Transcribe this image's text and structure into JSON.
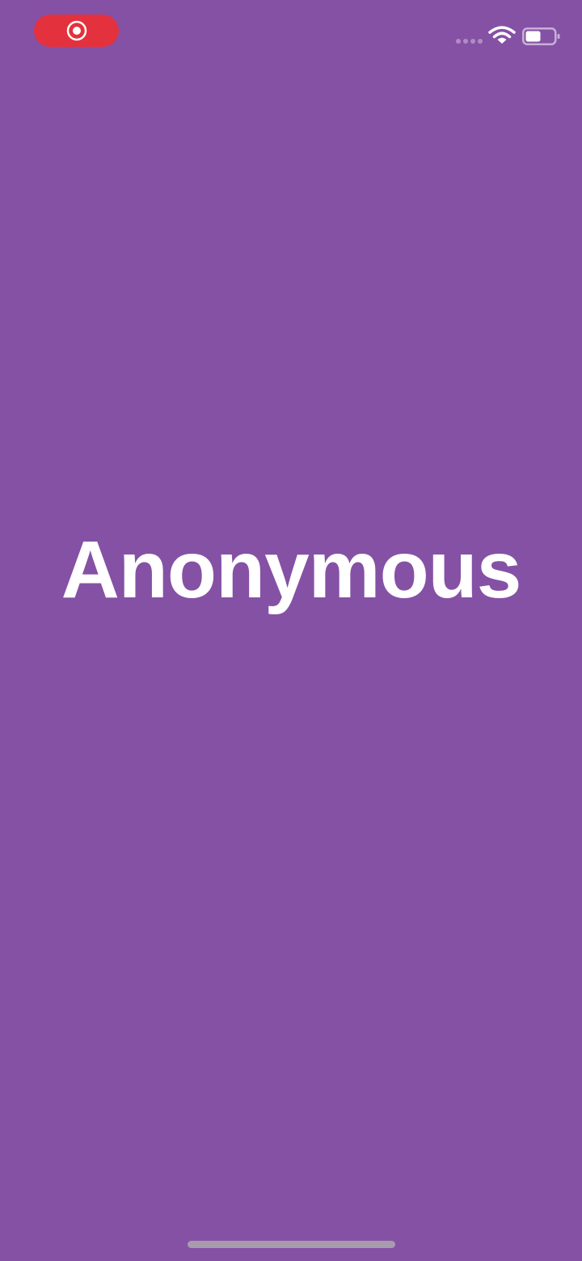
{
  "screen": {
    "background_color": "#8551A5",
    "title": "Anonymous"
  },
  "status_bar": {
    "recording_indicator_color": "#E3313D",
    "icons": [
      "record-icon",
      "cellular-signal-icon",
      "wifi-icon",
      "battery-icon"
    ],
    "battery_level": 0.5
  },
  "home_indicator": {
    "color": "#A89BAE"
  }
}
